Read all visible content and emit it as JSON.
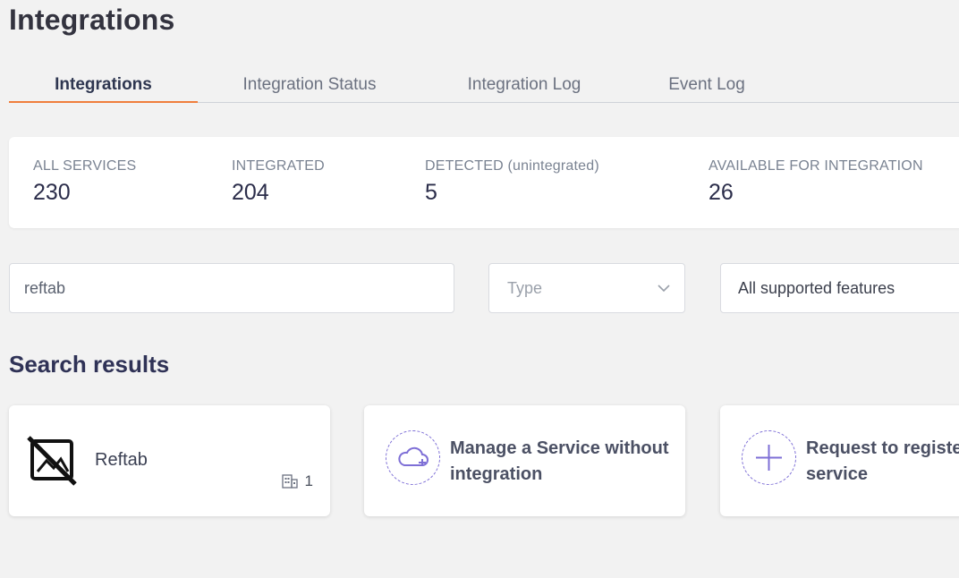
{
  "page": {
    "title": "Integrations"
  },
  "tabs": [
    {
      "label": "Integrations",
      "active": true
    },
    {
      "label": "Integration Status",
      "active": false
    },
    {
      "label": "Integration Log",
      "active": false
    },
    {
      "label": "Event Log",
      "active": false
    }
  ],
  "stats": [
    {
      "label": "ALL SERVICES",
      "value": "230"
    },
    {
      "label": "INTEGRATED",
      "value": "204"
    },
    {
      "label": "DETECTED (unintegrated)",
      "value": "5"
    },
    {
      "label": "AVAILABLE FOR INTEGRATION",
      "value": "26"
    }
  ],
  "filters": {
    "search_value": "reftab",
    "type_placeholder": "Type",
    "features_value": "All supported features"
  },
  "results": {
    "title": "Search results",
    "cards": [
      {
        "name": "Reftab",
        "count": "1",
        "icon": "no-image-icon"
      },
      {
        "line1": "Manage a Service without",
        "line2": "integration",
        "icon": "cloud-plus-icon"
      },
      {
        "line1": "Request to register",
        "line2": "service",
        "icon": "plus-icon"
      }
    ]
  },
  "colors": {
    "accent": "#f07e3c",
    "icon_purple": "#7e6fd6"
  }
}
